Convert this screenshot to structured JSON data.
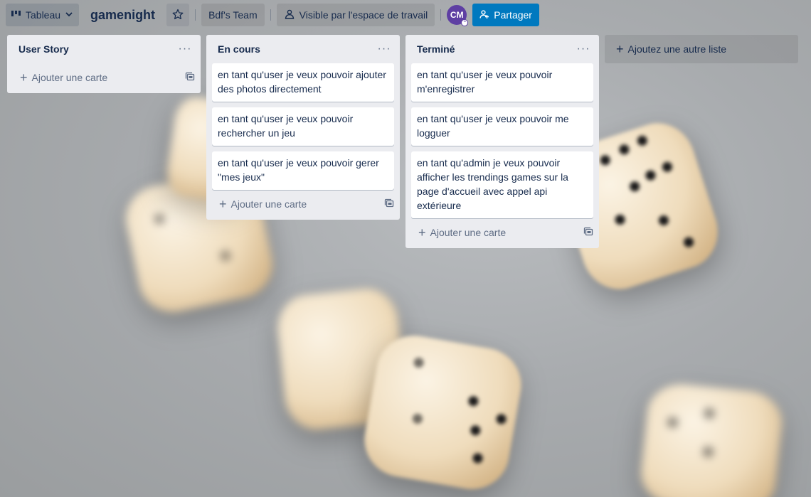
{
  "header": {
    "view_label": "Tableau",
    "board_title": "gamenight",
    "team_label": "Bdf's Team",
    "visibility_label": "Visible par l'espace de travail",
    "avatar_initials": "CM",
    "share_label": "Partager"
  },
  "lists": [
    {
      "title": "User Story",
      "cards": [],
      "add_card_label": "Ajouter une carte"
    },
    {
      "title": "En cours",
      "cards": [
        "en tant qu'user je veux pouvoir ajouter des photos directement",
        "en tant qu'user je veux pouvoir rechercher un jeu",
        "en tant qu'user je veux pouvoir gerer \"mes jeux\""
      ],
      "add_card_label": "Ajouter une carte"
    },
    {
      "title": "Terminé",
      "cards": [
        "en tant qu'user je veux pouvoir m'enregistrer",
        "en tant qu'user je veux pouvoir me logguer",
        "en tant qu'admin je veux pouvoir afficher les trendings games sur la page d'accueil avec appel api extérieure"
      ],
      "add_card_label": "Ajouter une carte"
    }
  ],
  "add_list_label": "Ajoutez une autre liste",
  "colors": {
    "share_button": "#0079bf",
    "list_bg": "#ebecf0",
    "avatar": "#5e3fa3"
  }
}
